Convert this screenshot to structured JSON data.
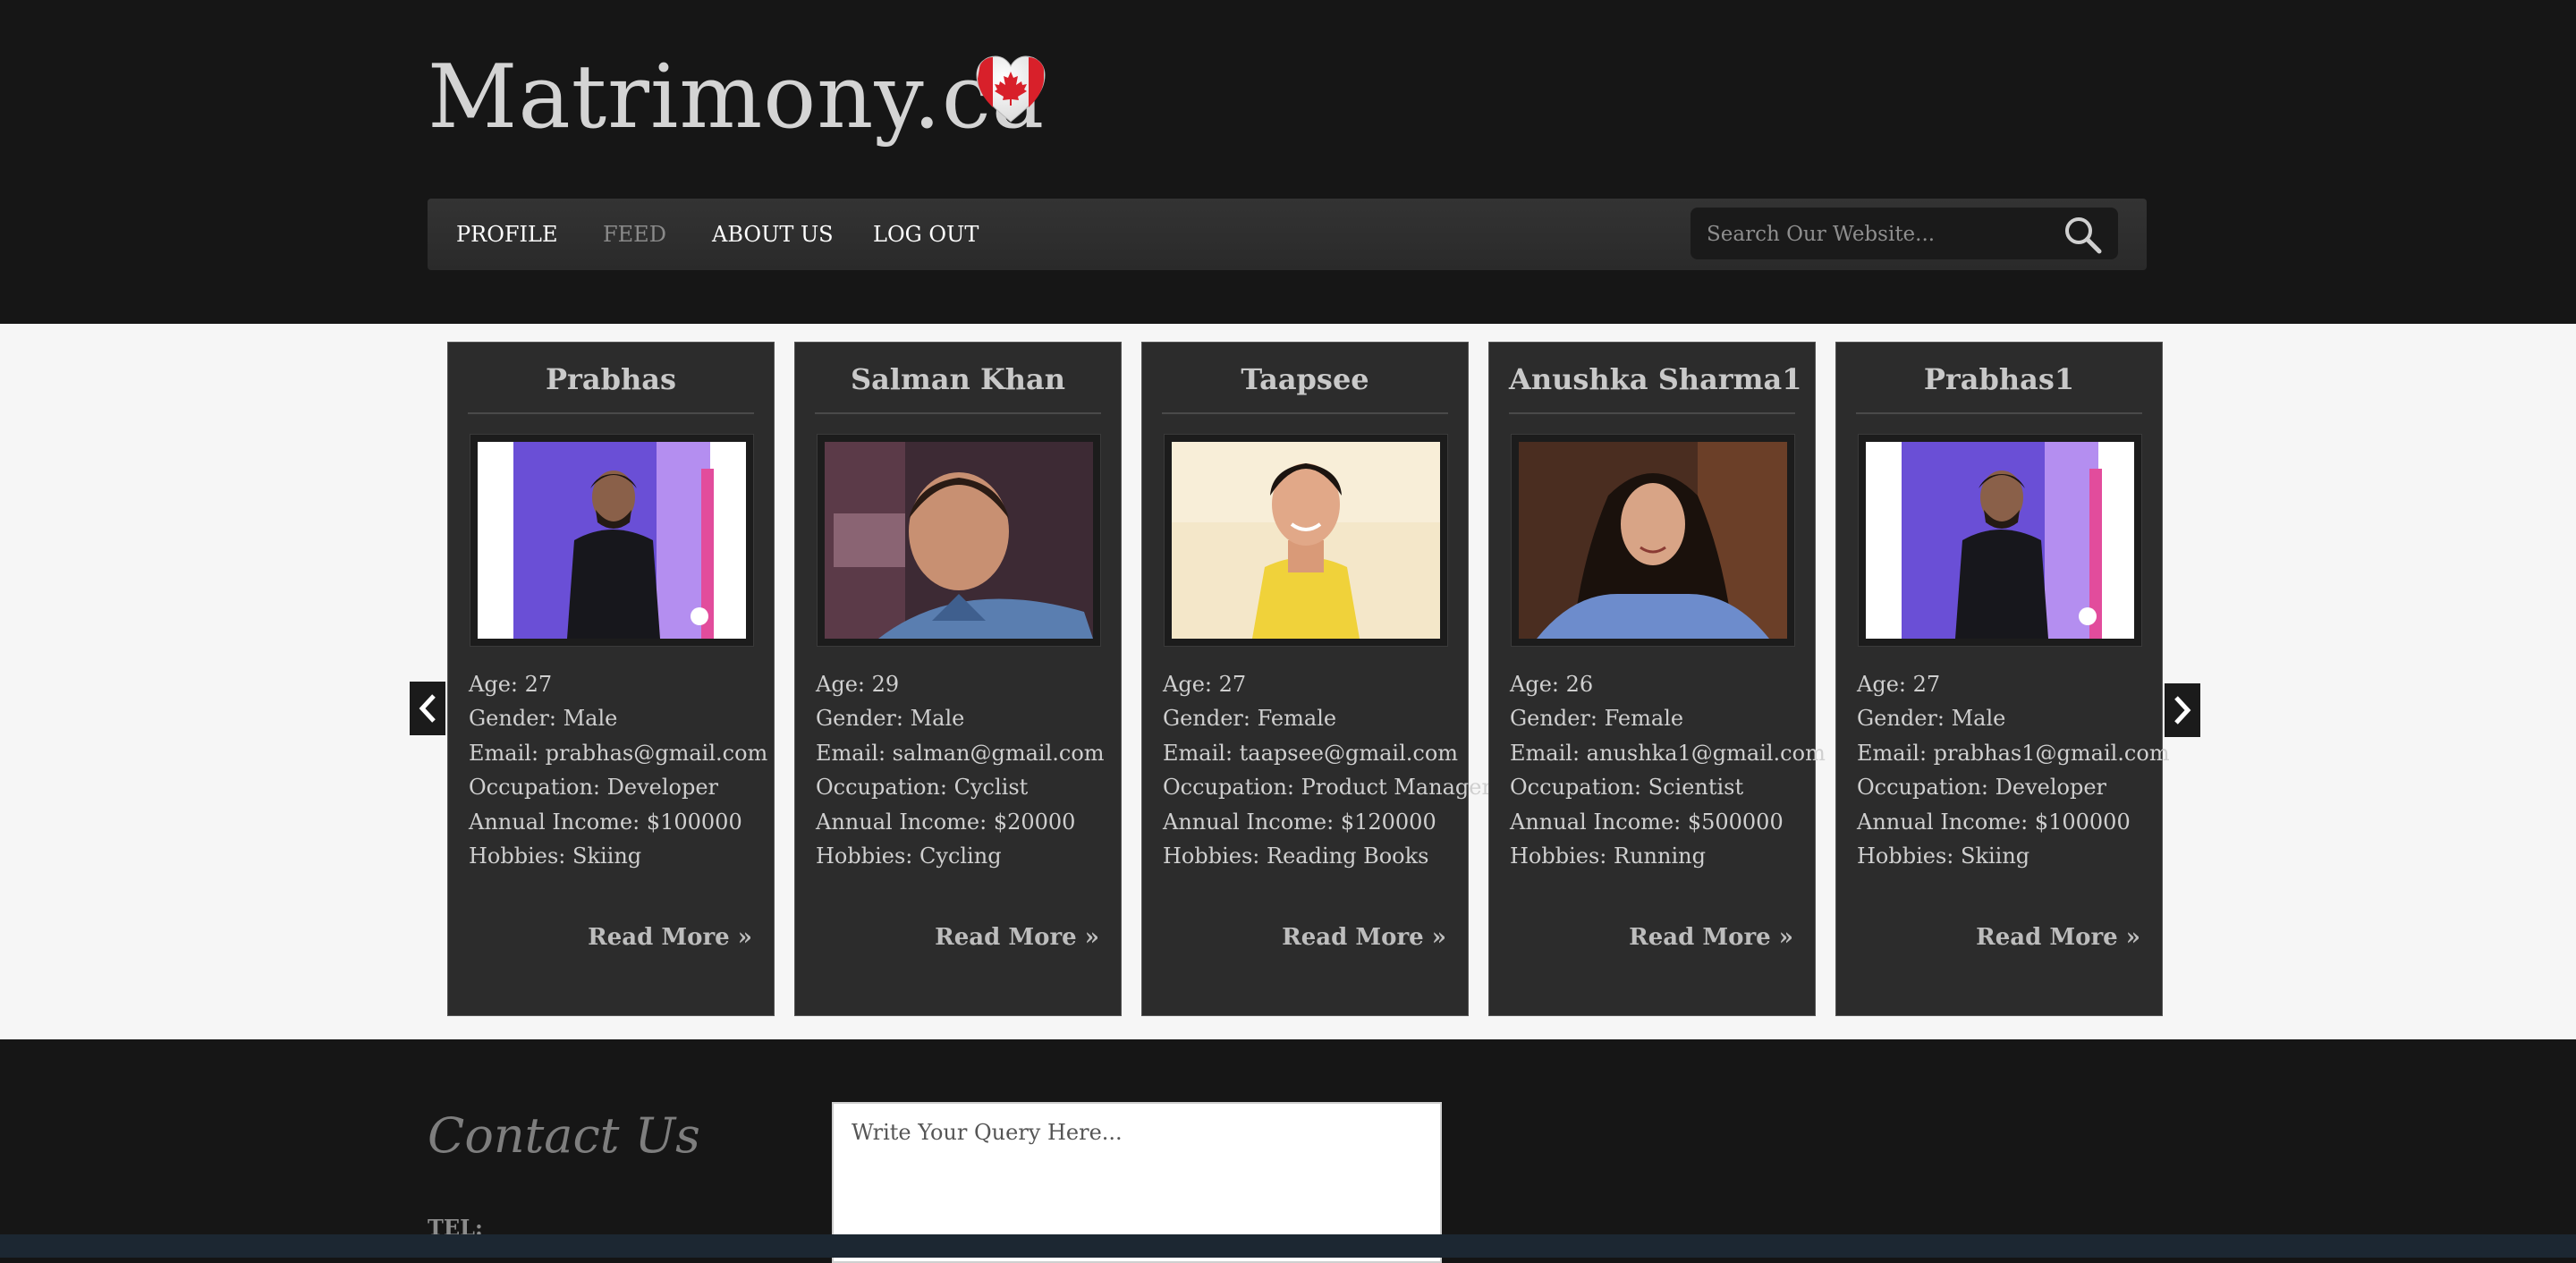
{
  "site": {
    "title": "Matrimony.ca",
    "logo_icon": "canada-flag-heart-icon"
  },
  "nav": {
    "items": [
      {
        "label": "PROFILE",
        "active": false
      },
      {
        "label": "FEED",
        "active": true
      },
      {
        "label": "ABOUT US",
        "active": false
      },
      {
        "label": "LOG OUT",
        "active": false
      }
    ]
  },
  "search": {
    "placeholder": "Search Our Website...",
    "icon": "search-icon"
  },
  "carousel": {
    "prev_icon": "chevron-left-icon",
    "next_icon": "chevron-right-icon",
    "profiles": [
      {
        "name": "Prabhas",
        "age": "Age: 27",
        "gender": "Gender: Male",
        "email": "Email: prabhas@gmail.com",
        "occupation": "Occupation: Developer",
        "income": "Annual Income: $100000",
        "hobbies": "Hobbies: Skiing",
        "read_more": "Read More »"
      },
      {
        "name": "Salman Khan",
        "age": "Age: 29",
        "gender": "Gender: Male",
        "email": "Email: salman@gmail.com",
        "occupation": "Occupation: Cyclist",
        "income": "Annual Income: $20000",
        "hobbies": "Hobbies: Cycling",
        "read_more": "Read More »"
      },
      {
        "name": "Taapsee",
        "age": "Age: 27",
        "gender": "Gender: Female",
        "email": "Email: taapsee@gmail.com",
        "occupation": "Occupation: Product Manager",
        "income": "Annual Income: $120000",
        "hobbies": "Hobbies: Reading Books",
        "read_more": "Read More »"
      },
      {
        "name": "Anushka Sharma1",
        "age": "Age: 26",
        "gender": "Gender: Female",
        "email": "Email: anushka1@gmail.com",
        "occupation": "Occupation: Scientist",
        "income": "Annual Income: $500000",
        "hobbies": "Hobbies: Running",
        "read_more": "Read More »"
      },
      {
        "name": "Prabhas1",
        "age": "Age: 27",
        "gender": "Gender: Male",
        "email": "Email: prabhas1@gmail.com",
        "occupation": "Occupation: Developer",
        "income": "Annual Income: $100000",
        "hobbies": "Hobbies: Skiing",
        "read_more": "Read More »"
      }
    ]
  },
  "footer": {
    "contact_title": "Contact Us",
    "query_placeholder": "Write Your Query Here...",
    "tel_label": "TEL:"
  },
  "colors": {
    "header_bg": "#161616",
    "nav_bg": "#2f2f2f",
    "card_bg": "#2c2c2c",
    "content_bg": "#f6f6f6"
  }
}
